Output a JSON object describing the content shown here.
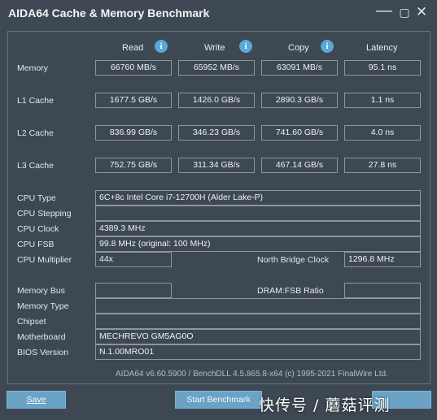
{
  "window": {
    "title": "AIDA64 Cache & Memory Benchmark",
    "minimize_glyph": "—",
    "maximize_glyph": "▢",
    "close_glyph": "✕"
  },
  "columns": {
    "read": "Read",
    "write": "Write",
    "copy": "Copy",
    "latency": "Latency",
    "info_glyph": "i"
  },
  "bench": {
    "memory": {
      "label": "Memory",
      "read": "66760 MB/s",
      "write": "65952 MB/s",
      "copy": "63091 MB/s",
      "latency": "95.1 ns"
    },
    "l1": {
      "label": "L1 Cache",
      "read": "1677.5 GB/s",
      "write": "1426.0 GB/s",
      "copy": "2890.3 GB/s",
      "latency": "1.1 ns"
    },
    "l2": {
      "label": "L2 Cache",
      "read": "836.99 GB/s",
      "write": "346.23 GB/s",
      "copy": "741.60 GB/s",
      "latency": "4.0 ns"
    },
    "l3": {
      "label": "L3 Cache",
      "read": "752.75 GB/s",
      "write": "311.34 GB/s",
      "copy": "467.14 GB/s",
      "latency": "27.8 ns"
    }
  },
  "cpu": {
    "type_label": "CPU Type",
    "type": "6C+8c Intel Core i7-12700H  (Alder Lake-P)",
    "stepping_label": "CPU Stepping",
    "stepping": "",
    "clock_label": "CPU Clock",
    "clock": "4389.3 MHz",
    "fsb_label": "CPU FSB",
    "fsb": "99.8 MHz  (original: 100 MHz)",
    "multiplier_label": "CPU Multiplier",
    "multiplier": "44x",
    "nb_clock_label": "North Bridge Clock",
    "nb_clock": "1296.8 MHz"
  },
  "system": {
    "membus_label": "Memory Bus",
    "membus": "",
    "ratio_label": "DRAM:FSB Ratio",
    "ratio": "",
    "memtype_label": "Memory Type",
    "memtype": "",
    "chipset_label": "Chipset",
    "chipset": "",
    "motherboard_label": "Motherboard",
    "motherboard": "MECHREVO GM5AG0O",
    "bios_label": "BIOS Version",
    "bios": "N.1.00MRO01"
  },
  "footer": "AIDA64 v6.60.5900 / BenchDLL 4.5.865.8-x64  (c) 1995-2021 FinalWire Ltd.",
  "buttons": {
    "save": "Save",
    "start": "Start Benchmark"
  },
  "watermark": "快传号 / 蘑菇评测"
}
